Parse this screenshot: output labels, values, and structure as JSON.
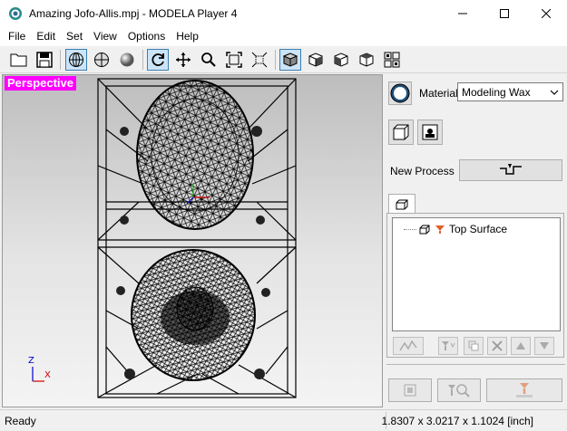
{
  "window": {
    "title": "Amazing Jofo-Allis.mpj - MODELA Player 4",
    "app_icon": "modela-app-icon",
    "controls": [
      "minimize-icon",
      "maximize-icon",
      "close-icon"
    ]
  },
  "menu": {
    "items": [
      "File",
      "Edit",
      "Set",
      "View",
      "Options",
      "Help"
    ]
  },
  "toolbar": {
    "buttons": [
      {
        "icon": "open-folder-icon",
        "active": false
      },
      {
        "icon": "save-icon",
        "active": false
      },
      {
        "icon": "wireframe-globe-icon",
        "active": true
      },
      {
        "icon": "half-globe-icon",
        "active": false
      },
      {
        "icon": "shaded-sphere-icon",
        "active": false
      },
      {
        "icon": "rotate-icon",
        "active": true
      },
      {
        "icon": "move-icon",
        "active": false
      },
      {
        "icon": "zoom-icon",
        "active": false
      },
      {
        "icon": "fit-view-icon",
        "active": false
      },
      {
        "icon": "zoom-region-icon",
        "active": false
      },
      {
        "icon": "view-iso-icon",
        "active": true
      },
      {
        "icon": "view-front-icon",
        "active": false
      },
      {
        "icon": "view-side-icon",
        "active": false
      },
      {
        "icon": "view-top-icon",
        "active": false
      },
      {
        "icon": "multi-view-icon",
        "active": false
      }
    ]
  },
  "viewport": {
    "view_label": "Perspective",
    "axis_z": "Z",
    "axis_x": "X",
    "label_color": "#ff00ff"
  },
  "panel": {
    "material_label": "Material",
    "material_value": "Modeling Wax",
    "new_process_label": "New Process",
    "tree_item_label": "Top Surface"
  },
  "status": {
    "left": "Ready",
    "right": "1.8307 x 3.0217 x 1.1024 [inch]"
  }
}
